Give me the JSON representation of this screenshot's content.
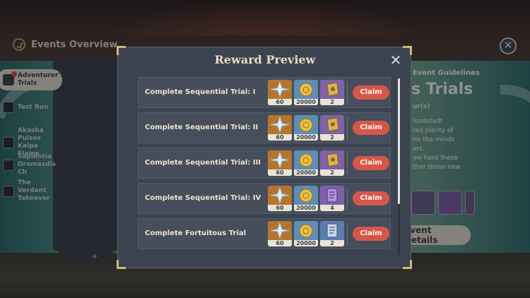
{
  "background": {
    "events_overview_label": "Events Overview",
    "sidebar_items": [
      {
        "label": "Adventurer's Trials",
        "icon": "adventurer-icon"
      },
      {
        "label": "Test Run",
        "icon": "test-run-icon"
      },
      {
        "label": "Akasha Pulses Kalpa Flame",
        "icon": "akasha-icon"
      },
      {
        "label": "Sapientia Oromasdis Ch",
        "icon": "sapientia-icon"
      },
      {
        "label": "The Verdant Takeover",
        "icon": "verdant-icon"
      }
    ],
    "event_guidelines_label": "Event Guidelines",
    "event_title_fragment": "s Trials",
    "duration_fragment": "ur(s)",
    "desc_lines": [
      "londstadt",
      "red plenty of",
      "ne the minds",
      "ers.",
      "ow hard these",
      "ther those new"
    ],
    "event_details_button": "Event Details"
  },
  "modal": {
    "title": "Reward Preview",
    "close_icon": "close-icon",
    "rows": [
      {
        "label": "Complete Sequential Trial: I",
        "rewards": [
          {
            "icon": "primogem-icon",
            "qty": "60"
          },
          {
            "icon": "mora-icon",
            "qty": "20000"
          },
          {
            "icon": "talent-book-icon",
            "qty": "2"
          }
        ],
        "claim": "Claim"
      },
      {
        "label": "Complete Sequential Trial: II",
        "rewards": [
          {
            "icon": "primogem-icon",
            "qty": "60"
          },
          {
            "icon": "mora-icon",
            "qty": "20000"
          },
          {
            "icon": "talent-book-icon",
            "qty": "2"
          }
        ],
        "claim": "Claim"
      },
      {
        "label": "Complete Sequential Trial: III",
        "rewards": [
          {
            "icon": "primogem-icon",
            "qty": "60"
          },
          {
            "icon": "mora-icon",
            "qty": "20000"
          },
          {
            "icon": "talent-book-icon",
            "qty": "2"
          }
        ],
        "claim": "Claim"
      },
      {
        "label": "Complete Sequential Trial: IV",
        "rewards": [
          {
            "icon": "primogem-icon",
            "qty": "60"
          },
          {
            "icon": "mora-icon",
            "qty": "20000"
          },
          {
            "icon": "purple-book-icon",
            "qty": "4"
          }
        ],
        "claim": "Claim"
      },
      {
        "label": "Complete Fortuitous Trial",
        "rewards": [
          {
            "icon": "primogem-icon",
            "qty": "60"
          },
          {
            "icon": "mora-icon",
            "qty": "20000"
          },
          {
            "icon": "blue-book-icon",
            "qty": "2"
          }
        ],
        "claim": "Claim"
      }
    ]
  },
  "colors": {
    "claim": "#d5574a",
    "accent_gold": "#d4b67a",
    "panel": "#3c4350"
  }
}
